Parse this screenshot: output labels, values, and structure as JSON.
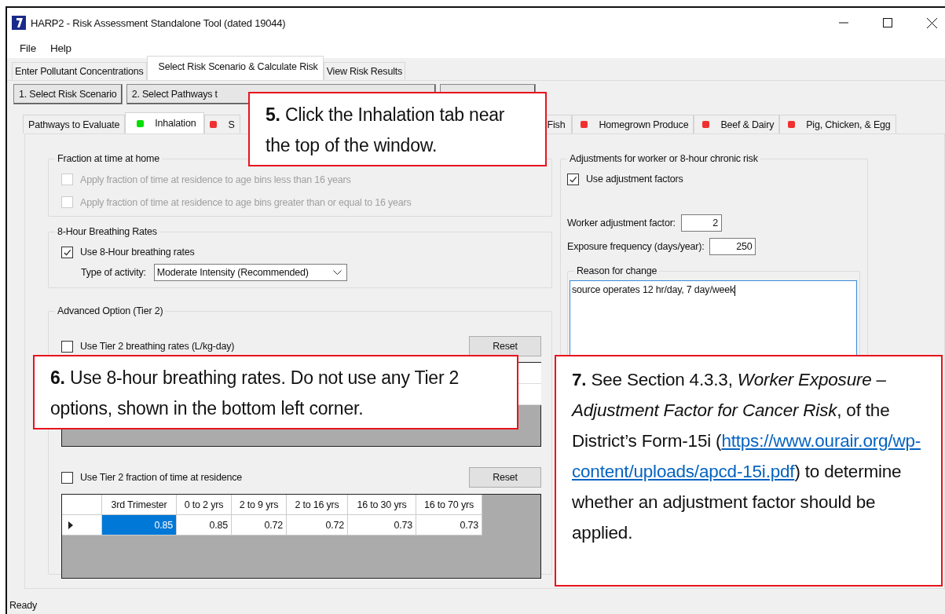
{
  "window": {
    "title": "HARP2 - Risk Assessment Standalone Tool (dated 19044)"
  },
  "menu": [
    "File",
    "Help"
  ],
  "main_tabs": [
    {
      "label": "Enter Pollutant Concentrations",
      "selected": false
    },
    {
      "label": "Select Risk Scenario & Calculate Risk",
      "selected": true
    },
    {
      "label": "View Risk Results",
      "selected": false
    }
  ],
  "step_buttons": [
    "1.  Select Risk Scenario",
    "2.  Select Pathways t"
  ],
  "pathway_tabs": [
    {
      "label": "Pathways to Evaluate",
      "selected": false
    },
    {
      "label": "Inhalation",
      "selected": true,
      "color": "#00e000"
    },
    {
      "label": "S",
      "selected": false,
      "color": "#f03030"
    },
    {
      "label": "Fish",
      "selected": false
    },
    {
      "label": "Homegrown Produce",
      "selected": false,
      "color": "#f03030"
    },
    {
      "label": "Beef & Dairy",
      "selected": false,
      "color": "#f03030"
    },
    {
      "label": "Pig, Chicken, & Egg",
      "selected": false,
      "color": "#f03030"
    }
  ],
  "fraction_group": {
    "title": "Fraction at time at home",
    "options": [
      {
        "label": "Apply fraction of time at residence to age bins less than 16 years",
        "checked": false,
        "disabled": true
      },
      {
        "label": "Apply fraction of time at residence to age bins greater than or equal to 16 years",
        "checked": false,
        "disabled": true
      }
    ]
  },
  "breathing_group": {
    "title": "8-Hour Breathing Rates",
    "option": {
      "label": "Use 8-Hour breathing rates",
      "checked": true
    },
    "activity_label": "Type of activity:",
    "activity_value": "Moderate Intensity (Recommended)"
  },
  "advanced_group": {
    "title": "Advanced Option (Tier 2)",
    "breathing_option": {
      "label": "Use Tier 2 breathing rates (L/kg-day)",
      "checked": false
    },
    "breathing_reset": "Reset",
    "fraction_option": {
      "label": "Use Tier 2 fraction of time at residence",
      "checked": false
    },
    "fraction_reset": "Reset",
    "fraction_table": {
      "columns": [
        "3rd Trimester",
        "0 to 2 yrs",
        "2 to 9 yrs",
        "2 to 16 yrs",
        "16 to 30 yrs",
        "16 to 70 yrs"
      ],
      "rows": [
        {
          "current": true,
          "cells": [
            {
              "value": "0.85",
              "selected": true
            },
            {
              "value": "0.85",
              "selected": false
            },
            {
              "value": "0.72",
              "selected": false
            },
            {
              "value": "0.72",
              "selected": false
            },
            {
              "value": "0.73",
              "selected": false
            },
            {
              "value": "0.73",
              "selected": false
            }
          ]
        }
      ]
    }
  },
  "adjust_group": {
    "title": "Adjustments for worker or 8-hour chronic risk",
    "option": {
      "label": "Use adjustment factors",
      "checked": true
    },
    "fields": [
      {
        "label": "Worker adjustment factor:",
        "value": "2"
      },
      {
        "label": "Exposure frequency (days/year):",
        "value": "250"
      }
    ],
    "reason": {
      "title": "Reason for change",
      "value": "source operates 12 hr/day, 7 day/week"
    }
  },
  "status_bar": "Ready",
  "callouts": [
    {
      "text": "**5.**  Click the Inhalation tab near the top of the window."
    },
    {
      "text": "**6.**  Use 8-hour breathing rates.  Do not use any Tier 2 options, shown in the bottom left corner."
    },
    {
      "text": "**7.**  See Section 4.3.3, *Worker Exposure – Adjustment Factor for Cancer Risk*, of the District’s Form-15i (",
      "link_lines": [
        "https://www.ourair.org/wp-",
        "content/uploads/apcd-15i.pdf"
      ],
      "text_after": ") to determine whether an adjustment factor should be applied."
    }
  ]
}
